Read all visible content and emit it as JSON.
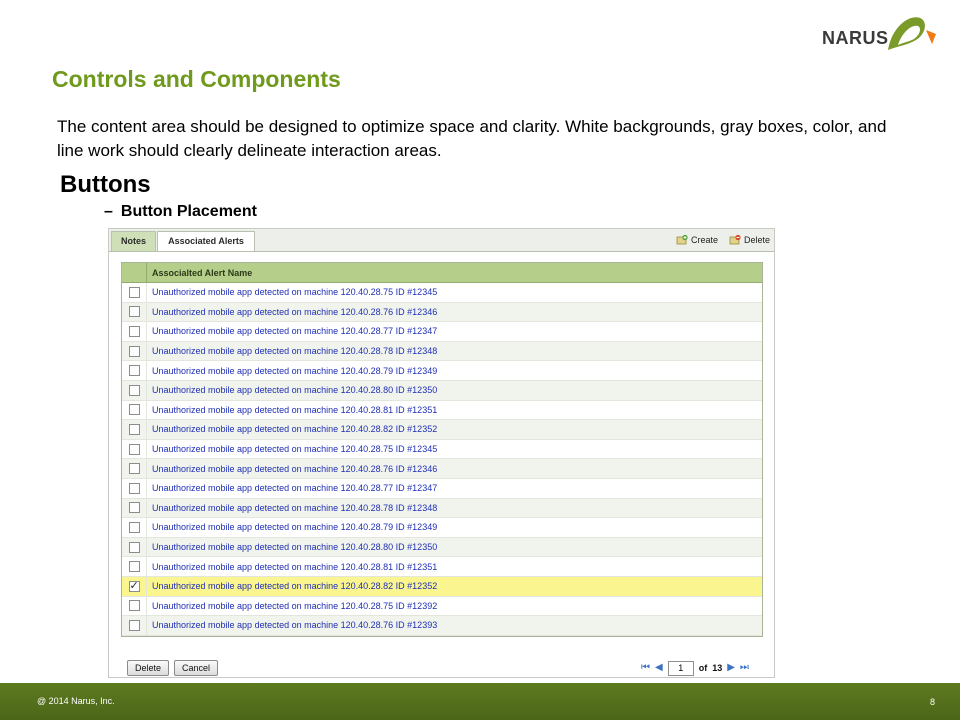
{
  "logo": {
    "text": "NARUS"
  },
  "slide": {
    "title": "Controls and Components",
    "intro": "The content area should be designed to optimize space and clarity.  White backgrounds, gray boxes, color, and line work should clearly delineate interaction areas.",
    "heading": "Buttons",
    "sub_dash": "–",
    "sub_bullet": "Button Placement"
  },
  "panel": {
    "tabs": [
      {
        "label": "Notes",
        "active": false
      },
      {
        "label": "Associated Alerts",
        "active": true
      }
    ],
    "toolbar": {
      "create_label": "Create",
      "delete_label": "Delete"
    },
    "grid": {
      "column_header": "Associalted Alert Name",
      "rows": [
        {
          "text": "Unauthorized mobile app detected on machine 120.40.28.75 ID #12345",
          "checked": false
        },
        {
          "text": "Unauthorized mobile app detected on machine 120.40.28.76 ID #12346",
          "checked": false
        },
        {
          "text": "Unauthorized mobile app detected on machine 120.40.28.77 ID #12347",
          "checked": false
        },
        {
          "text": "Unauthorized mobile app detected on machine 120.40.28.78 ID #12348",
          "checked": false
        },
        {
          "text": "Unauthorized mobile app detected on machine 120.40.28.79 ID #12349",
          "checked": false
        },
        {
          "text": "Unauthorized mobile app detected on machine 120.40.28.80 ID #12350",
          "checked": false
        },
        {
          "text": "Unauthorized mobile app detected on machine 120.40.28.81 ID #12351",
          "checked": false
        },
        {
          "text": "Unauthorized mobile app detected on machine 120.40.28.82 ID #12352",
          "checked": false
        },
        {
          "text": "Unauthorized mobile app detected on machine 120.40.28.75 ID #12345",
          "checked": false
        },
        {
          "text": "Unauthorized mobile app detected on machine 120.40.28.76 ID #12346",
          "checked": false
        },
        {
          "text": "Unauthorized mobile app detected on machine 120.40.28.77 ID #12347",
          "checked": false
        },
        {
          "text": "Unauthorized mobile app detected on machine 120.40.28.78 ID #12348",
          "checked": false
        },
        {
          "text": "Unauthorized mobile app detected on machine 120.40.28.79 ID #12349",
          "checked": false
        },
        {
          "text": "Unauthorized mobile app detected on machine 120.40.28.80 ID #12350",
          "checked": false
        },
        {
          "text": "Unauthorized mobile app detected on machine 120.40.28.81 ID #12351",
          "checked": false
        },
        {
          "text": "Unauthorized mobile app detected on machine 120.40.28.82 ID #12352",
          "checked": true
        },
        {
          "text": "Unauthorized mobile app detected on machine 120.40.28.75 ID #12392",
          "checked": false
        },
        {
          "text": "Unauthorized mobile app detected on machine 120.40.28.76 ID #12393",
          "checked": false
        }
      ]
    },
    "buttons": {
      "delete_label": "Delete",
      "cancel_label": "Cancel"
    },
    "pager": {
      "page": "1",
      "of_label": "of",
      "total": "13"
    }
  },
  "footer": {
    "copyright": "@ 2014 Narus, Inc.",
    "page_number": "8"
  },
  "colors": {
    "title_green": "#6f9a1c",
    "footer_green": "#5d7a20",
    "grid_header": "#b5cf8a",
    "selected_row": "#fbf58f",
    "link_blue": "#1f2fb5"
  }
}
